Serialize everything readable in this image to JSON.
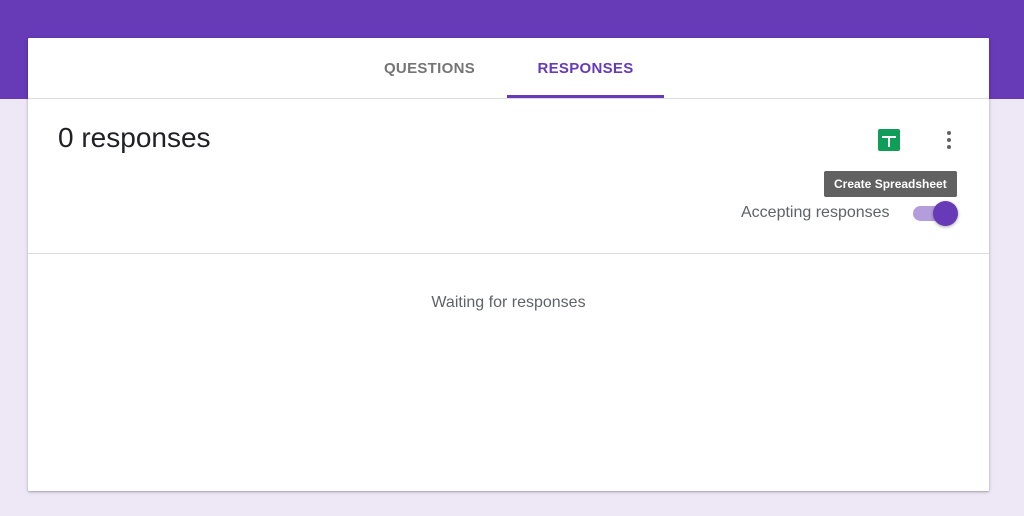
{
  "tabs": [
    {
      "label": "QUESTIONS",
      "active": false
    },
    {
      "label": "RESPONSES",
      "active": true
    }
  ],
  "summary": {
    "count_text": "0 responses",
    "create_spreadsheet_tooltip": "Create Spreadsheet",
    "accepting_label": "Accepting responses",
    "accepting_on": true
  },
  "body": {
    "waiting_text": "Waiting for responses"
  },
  "icons": {
    "sheet": "sheets-icon",
    "more": "more-vert-icon"
  },
  "colors": {
    "brand": "#673ab7",
    "background": "#ede7f6",
    "sheets_green": "#0f9d58"
  }
}
